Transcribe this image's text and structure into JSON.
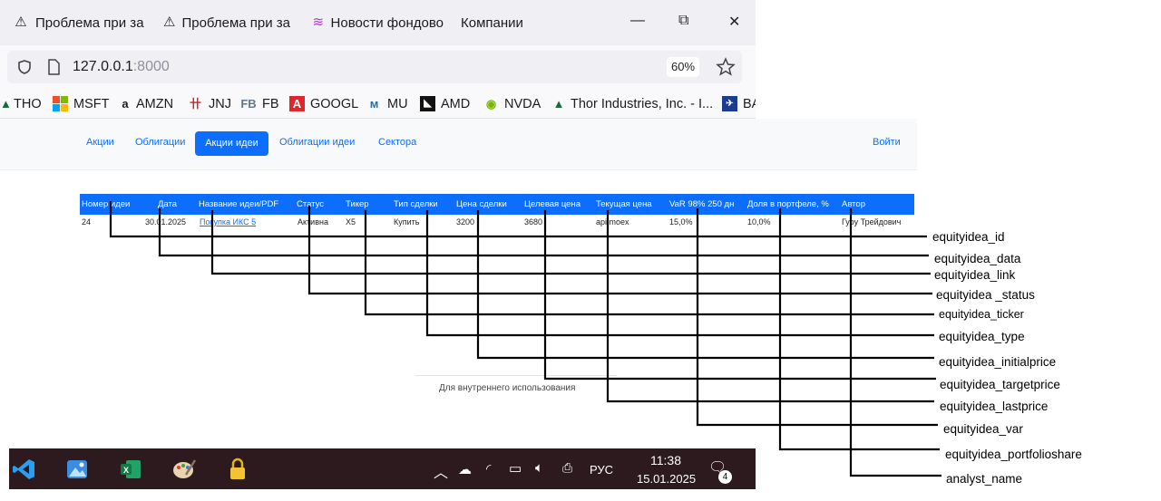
{
  "browser": {
    "tabs": [
      {
        "label": "Проблема при за",
        "icon": "warning-icon"
      },
      {
        "label": "Проблема при за",
        "icon": "warning-icon"
      },
      {
        "label": "Новости фондово",
        "icon": "news-icon"
      },
      {
        "label": "Компании",
        "icon": ""
      }
    ],
    "url_host": "127.0.0.1",
    "url_port": ":8000",
    "zoom": "60%",
    "bookmarks": [
      {
        "label": "THO",
        "icon": "tho-icon"
      },
      {
        "label": "MSFT",
        "icon": "microsoft-icon"
      },
      {
        "label": "AMZN",
        "icon": "amazon-icon"
      },
      {
        "label": "JNJ",
        "icon": "jnj-icon"
      },
      {
        "label": "FB",
        "icon": "fb-icon",
        "prefix": "FB"
      },
      {
        "label": "GOOGL",
        "icon": "google-icon"
      },
      {
        "label": "MU",
        "icon": "micron-icon"
      },
      {
        "label": "AMD",
        "icon": "amd-icon"
      },
      {
        "label": "NVDA",
        "icon": "nvidia-icon"
      },
      {
        "label": "Thor Industries, Inc. - I...",
        "icon": "thor-icon"
      },
      {
        "label": "BA",
        "icon": "boeing-icon"
      }
    ]
  },
  "nav": {
    "items": [
      "Акции",
      "Облигации",
      "Акции идеи",
      "Облигации идеи",
      "Сектора"
    ],
    "active": "Акции идеи",
    "login": "Войти"
  },
  "table": {
    "headers": [
      "Номер идеи",
      "Дата",
      "Название идеи/PDF",
      "Статус",
      "Тикер",
      "Тип сделки",
      "Цена сделки",
      "Целевая цена",
      "Текущая цена",
      "VaR 98% 250 дн",
      "Доля в портфеле, %",
      "Автор"
    ],
    "row": [
      "24",
      "30.01.2025",
      "Покупка ИКС 5",
      "Активна",
      "X5",
      "Купить",
      "3200",
      "3680",
      "api moex",
      "15,0%",
      "10,0%",
      "Гуру Трейдович"
    ]
  },
  "footer": "Для внутреннего использования",
  "annotations": [
    "equityidea_id",
    "equityidea_data",
    "equityidea_link",
    "equityidea _status",
    "equityidea_ticker",
    "equityidea_type",
    "equityidea_initialprice",
    "equityidea_targetprice",
    "equityidea_lastprice",
    "equityidea_var",
    "equityidea_portfolioshare",
    "analyst_name"
  ],
  "taskbar": {
    "apps": [
      "vscode-icon",
      "photos-icon",
      "excel-icon",
      "paint-icon",
      "lock-app-icon"
    ],
    "lang": "РУС",
    "time": "11:38",
    "date": "15.01.2025",
    "notifications": "4"
  },
  "colors": {
    "accent": "#0d6efd",
    "taskbar": "#2c1a1f"
  }
}
